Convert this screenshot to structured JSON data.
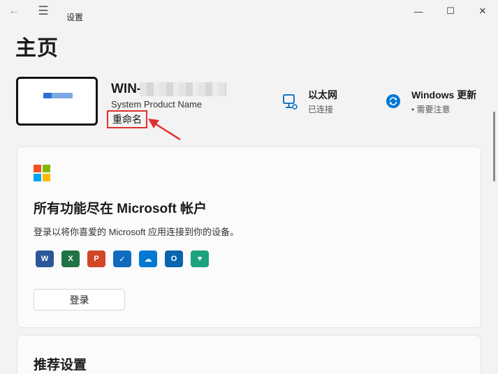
{
  "titlebar": {
    "app_title": "设置",
    "back_glyph": "←",
    "menu_glyph": "☰",
    "minimize_glyph": "—",
    "maximize_glyph": "☐",
    "close_glyph": "✕"
  },
  "page": {
    "title": "主页"
  },
  "device": {
    "name": "WIN-",
    "model": "System Product Name",
    "rename_label": "重命名"
  },
  "status": {
    "ethernet": {
      "title": "以太网",
      "subtitle": "已连接",
      "icon": "ethernet-icon"
    },
    "update": {
      "title": "Windows 更新",
      "subtitle": "• 需要注意",
      "icon": "sync-icon"
    }
  },
  "ms_card": {
    "title": "所有功能尽在 Microsoft 帐户",
    "description": "登录以将你喜爱的 Microsoft 应用连接到你的设备。",
    "signin_label": "登录",
    "apps": [
      {
        "name": "word-icon",
        "glyph": "W",
        "color": "#2b579a"
      },
      {
        "name": "excel-icon",
        "glyph": "X",
        "color": "#217346"
      },
      {
        "name": "powerpoint-icon",
        "glyph": "P",
        "color": "#d24726"
      },
      {
        "name": "defender-icon",
        "glyph": "✓",
        "color": "#0f6cbd"
      },
      {
        "name": "onedrive-icon",
        "glyph": "☁",
        "color": "#0078d4"
      },
      {
        "name": "outlook-icon",
        "glyph": "O",
        "color": "#0a64ad"
      },
      {
        "name": "family-icon",
        "glyph": "♥",
        "color": "#1ba37d"
      }
    ]
  },
  "recommended": {
    "title": "推荐设置"
  },
  "colors": {
    "accent": "#0067c0",
    "highlight": "#e03030"
  }
}
